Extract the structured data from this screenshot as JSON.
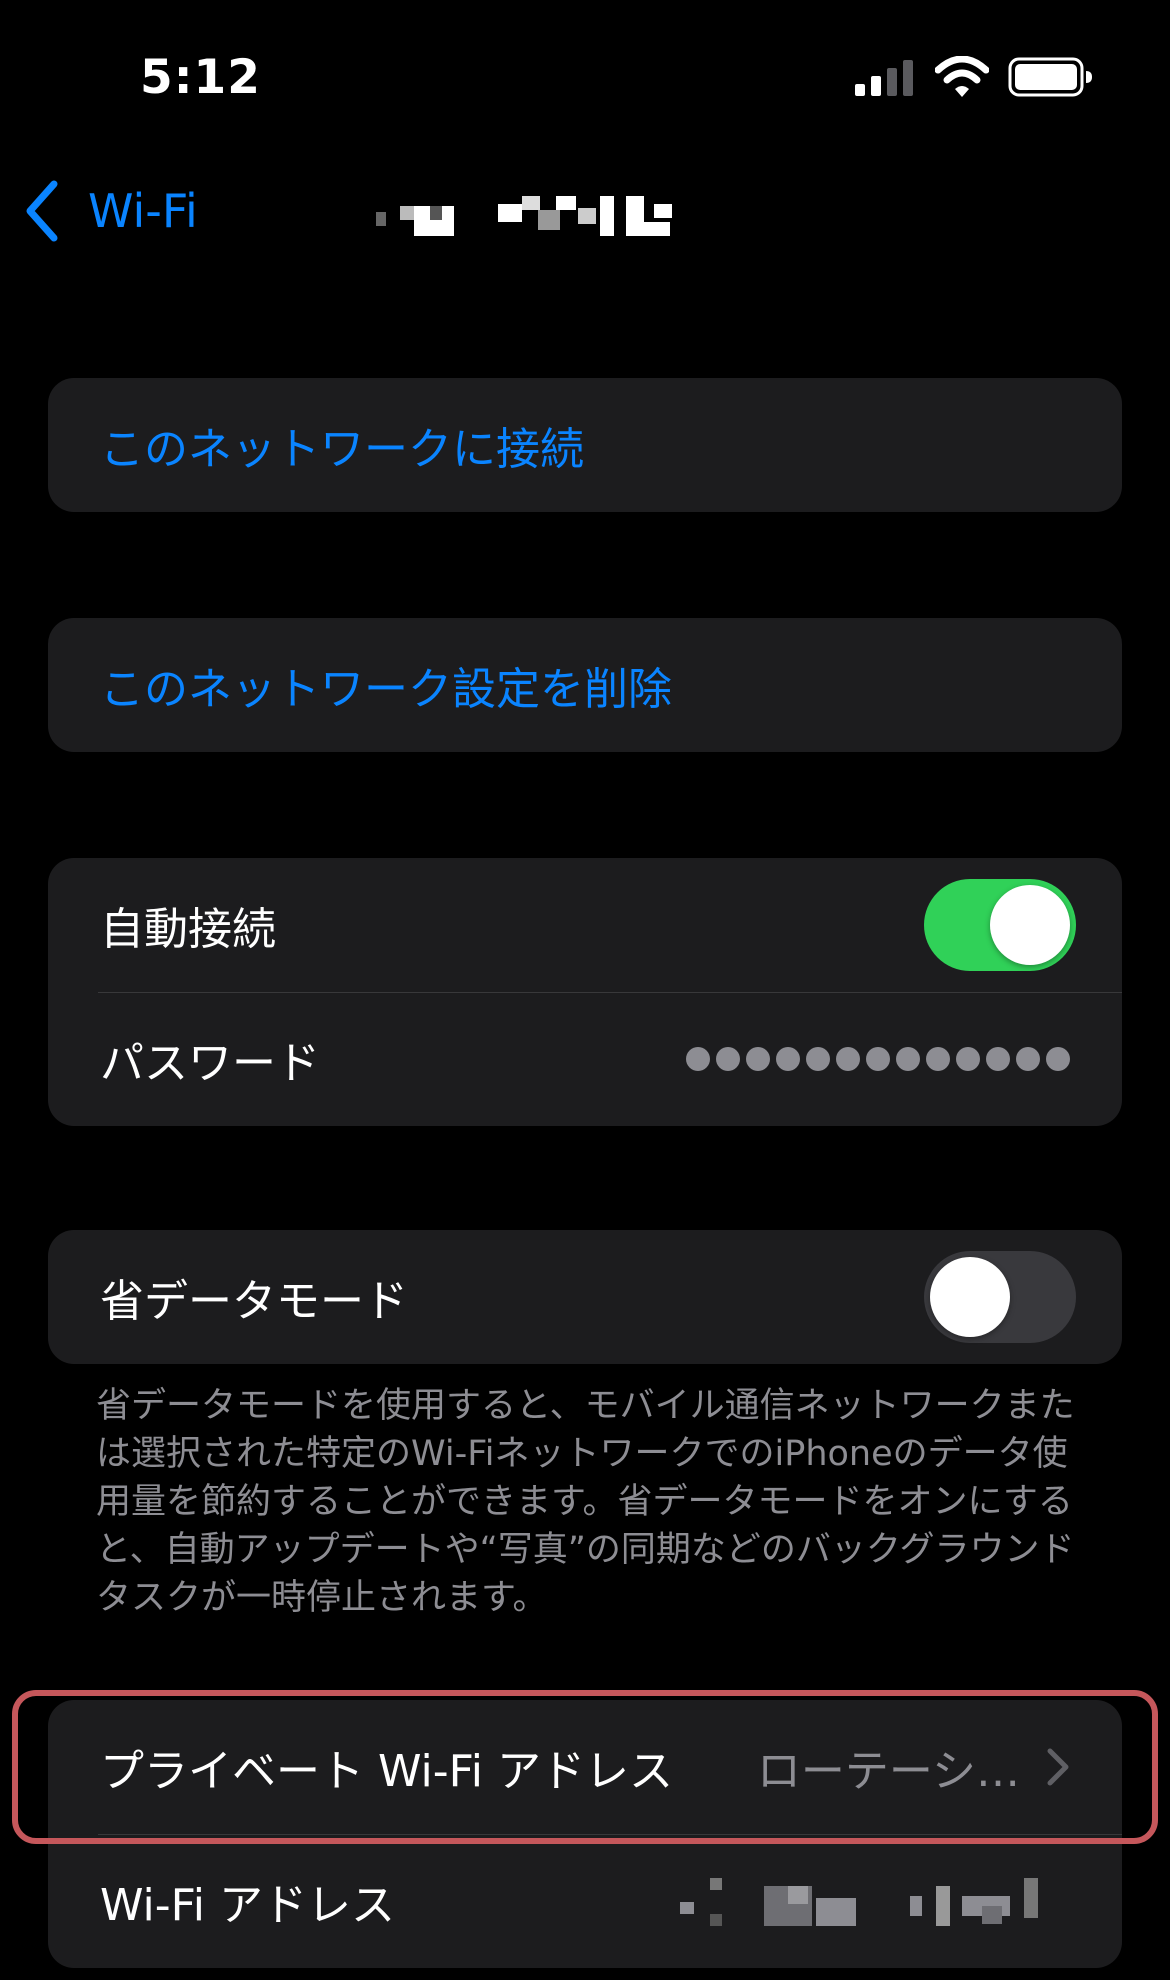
{
  "status_bar": {
    "time": "5:12",
    "icons": [
      "cellular-signal-icon",
      "wifi-icon",
      "battery-icon"
    ]
  },
  "nav": {
    "back_label": "Wi-Fi",
    "back_icon": "chevron-left-icon"
  },
  "actions": {
    "join": "このネットワークに接続",
    "forget": "このネットワーク設定を削除"
  },
  "auto_join": {
    "label": "自動接続",
    "enabled": true
  },
  "password": {
    "label": "パスワード",
    "masked_dot_count": 13
  },
  "low_data_mode": {
    "label": "省データモード",
    "enabled": false,
    "footnote": "省データモードを使用すると、モバイル通信ネットワークまたは選択された特定のWi-FiネットワークでのiPhoneのデータ使用量を節約することができます。省データモードをオンにすると、自動アップデートや“写真”の同期などのバックグラウンドタスクが一時停止されます。"
  },
  "private_address": {
    "label": "プライベート Wi-Fi アドレス",
    "value": "ローテーシ…"
  },
  "wifi_address": {
    "label": "Wi-Fi アドレス"
  },
  "colors": {
    "accent": "#0a84ff",
    "toggle_on": "#30d158",
    "group_bg": "#1c1c1e",
    "secondary_text": "#8d8d93",
    "highlight_border": "#c5575b"
  }
}
